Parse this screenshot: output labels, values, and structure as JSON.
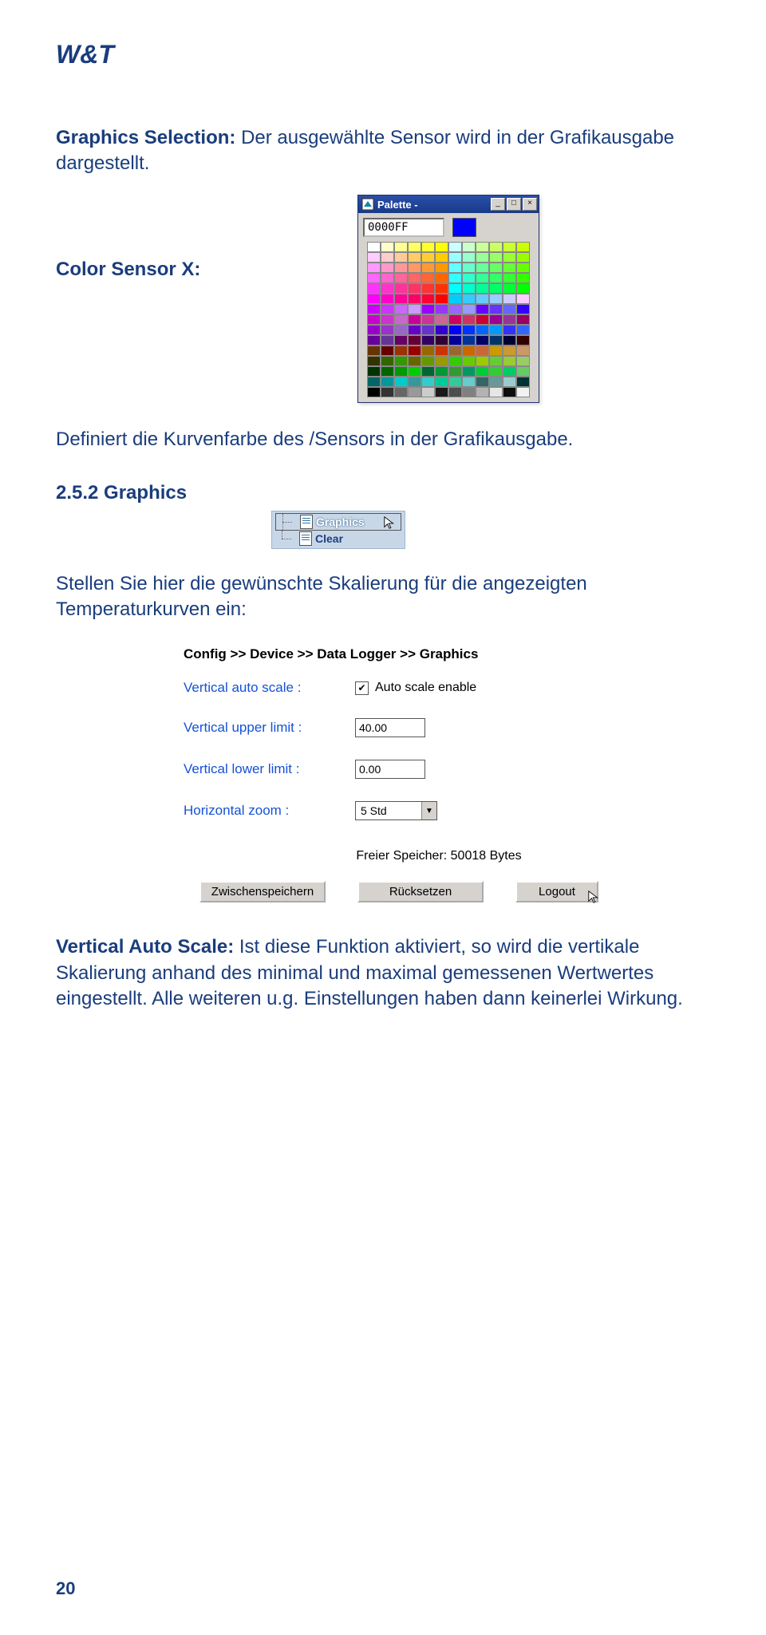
{
  "header": {
    "brand": "W&T"
  },
  "para1": {
    "label": "Graphics Selection:",
    "text": " Der ausgewählte Sensor wird in der Grafikausgabe dargestellt."
  },
  "para2": {
    "label": "Color Sensor X:"
  },
  "palette": {
    "title": "Palette -",
    "hex": "0000FF",
    "swatch": "#0000FF",
    "win_min": "_",
    "win_max": "□",
    "win_close": "×",
    "colors": [
      "#ffffff",
      "#ffffcc",
      "#ffff99",
      "#ffff66",
      "#ffff33",
      "#ffff00",
      "#ccffff",
      "#ccffcc",
      "#ccff99",
      "#ccff66",
      "#ccff33",
      "#ccff00",
      "#ffccff",
      "#ffcccc",
      "#ffcc99",
      "#ffcc66",
      "#ffcc33",
      "#ffcc00",
      "#99ffff",
      "#99ffcc",
      "#99ff99",
      "#99ff66",
      "#99ff33",
      "#99ff00",
      "#ff99ff",
      "#ff99cc",
      "#ff9999",
      "#ff9966",
      "#ff9933",
      "#ff9900",
      "#66ffff",
      "#66ffcc",
      "#66ff99",
      "#66ff66",
      "#66ff33",
      "#66ff00",
      "#ff66ff",
      "#ff66cc",
      "#ff6699",
      "#ff6666",
      "#ff6633",
      "#ff6600",
      "#33ffff",
      "#33ffcc",
      "#33ff99",
      "#33ff66",
      "#33ff33",
      "#33ff00",
      "#ff33ff",
      "#ff33cc",
      "#ff3399",
      "#ff3366",
      "#ff3333",
      "#ff3300",
      "#00ffff",
      "#00ffcc",
      "#00ff99",
      "#00ff66",
      "#00ff33",
      "#00ff00",
      "#ff00ff",
      "#ff00cc",
      "#ff0099",
      "#ff0066",
      "#ff0033",
      "#ff0000",
      "#00ccff",
      "#33ccff",
      "#66ccff",
      "#99ccff",
      "#ccccff",
      "#ffccff",
      "#cc00ff",
      "#cc33ff",
      "#cc66ff",
      "#cc99ff",
      "#9900ff",
      "#9933ff",
      "#9966ff",
      "#9999ff",
      "#6600ff",
      "#6633ff",
      "#6666ff",
      "#3300ff",
      "#cc00cc",
      "#cc33cc",
      "#cc66cc",
      "#cc0099",
      "#cc3399",
      "#cc6699",
      "#cc0066",
      "#cc3366",
      "#cc0033",
      "#990099",
      "#993399",
      "#990066",
      "#9900cc",
      "#9933cc",
      "#9966cc",
      "#6600cc",
      "#6633cc",
      "#3300cc",
      "#0000ff",
      "#0033ff",
      "#0066ff",
      "#0099ff",
      "#3333ff",
      "#3366ff",
      "#660099",
      "#663399",
      "#660066",
      "#660033",
      "#330066",
      "#330033",
      "#000099",
      "#003399",
      "#000066",
      "#003366",
      "#000033",
      "#330000",
      "#663300",
      "#660000",
      "#993300",
      "#990000",
      "#996600",
      "#cc3300",
      "#996633",
      "#cc6600",
      "#cc6633",
      "#cc9900",
      "#cc9933",
      "#cc9966",
      "#333300",
      "#336600",
      "#339900",
      "#666600",
      "#669900",
      "#999900",
      "#33cc00",
      "#66cc00",
      "#99cc00",
      "#66cc33",
      "#99cc33",
      "#99cc66",
      "#003300",
      "#006600",
      "#009900",
      "#00cc00",
      "#006633",
      "#009933",
      "#339933",
      "#009966",
      "#00cc33",
      "#33cc33",
      "#00cc66",
      "#66cc66",
      "#006666",
      "#009999",
      "#00cccc",
      "#339999",
      "#33cccc",
      "#00cc99",
      "#33cc99",
      "#66cccc",
      "#336666",
      "#669999",
      "#99cccc",
      "#003333",
      "#000000",
      "#333333",
      "#666666",
      "#999999",
      "#cccccc",
      "#1a1a1a",
      "#4d4d4d",
      "#808080",
      "#b3b3b3",
      "#e6e6e6",
      "#0d0d0d",
      "#f2f2f2"
    ]
  },
  "para3": "Definiert die Kurvenfarbe des /Sensors in der Grafikausgabe.",
  "section": "2.5.2 Graphics",
  "tree": {
    "graphics": "Graphics",
    "clear": "Clear"
  },
  "para4": "Stellen Sie hier die gewünschte Skalierung für die angezeigten Temperaturkurven ein:",
  "gform": {
    "breadcrumb": "Config >> Device >> Data Logger >> Graphics",
    "autoScale": {
      "label": "Vertical auto scale :",
      "text": "Auto scale enable",
      "checked": true
    },
    "upper": {
      "label": "Vertical upper limit :",
      "value": "40.00"
    },
    "lower": {
      "label": "Vertical lower limit :",
      "value": "0.00"
    },
    "zoom": {
      "label": "Horizontal zoom :",
      "value": "5 Std"
    },
    "freeMem": "Freier Speicher: 50018 Bytes",
    "btnSave": "Zwischenspeichern",
    "btnReset": "Rücksetzen",
    "btnLogout": "Logout"
  },
  "para5": {
    "label": "Vertical Auto Scale:",
    "text": " Ist diese Funktion aktiviert, so wird die vertikale Skalierung anhand des minimal und maximal gemessenen Wertwertes eingestellt. Alle weiteren u.g. Einstellungen haben dann keinerlei Wirkung."
  },
  "pageNumber": "20"
}
